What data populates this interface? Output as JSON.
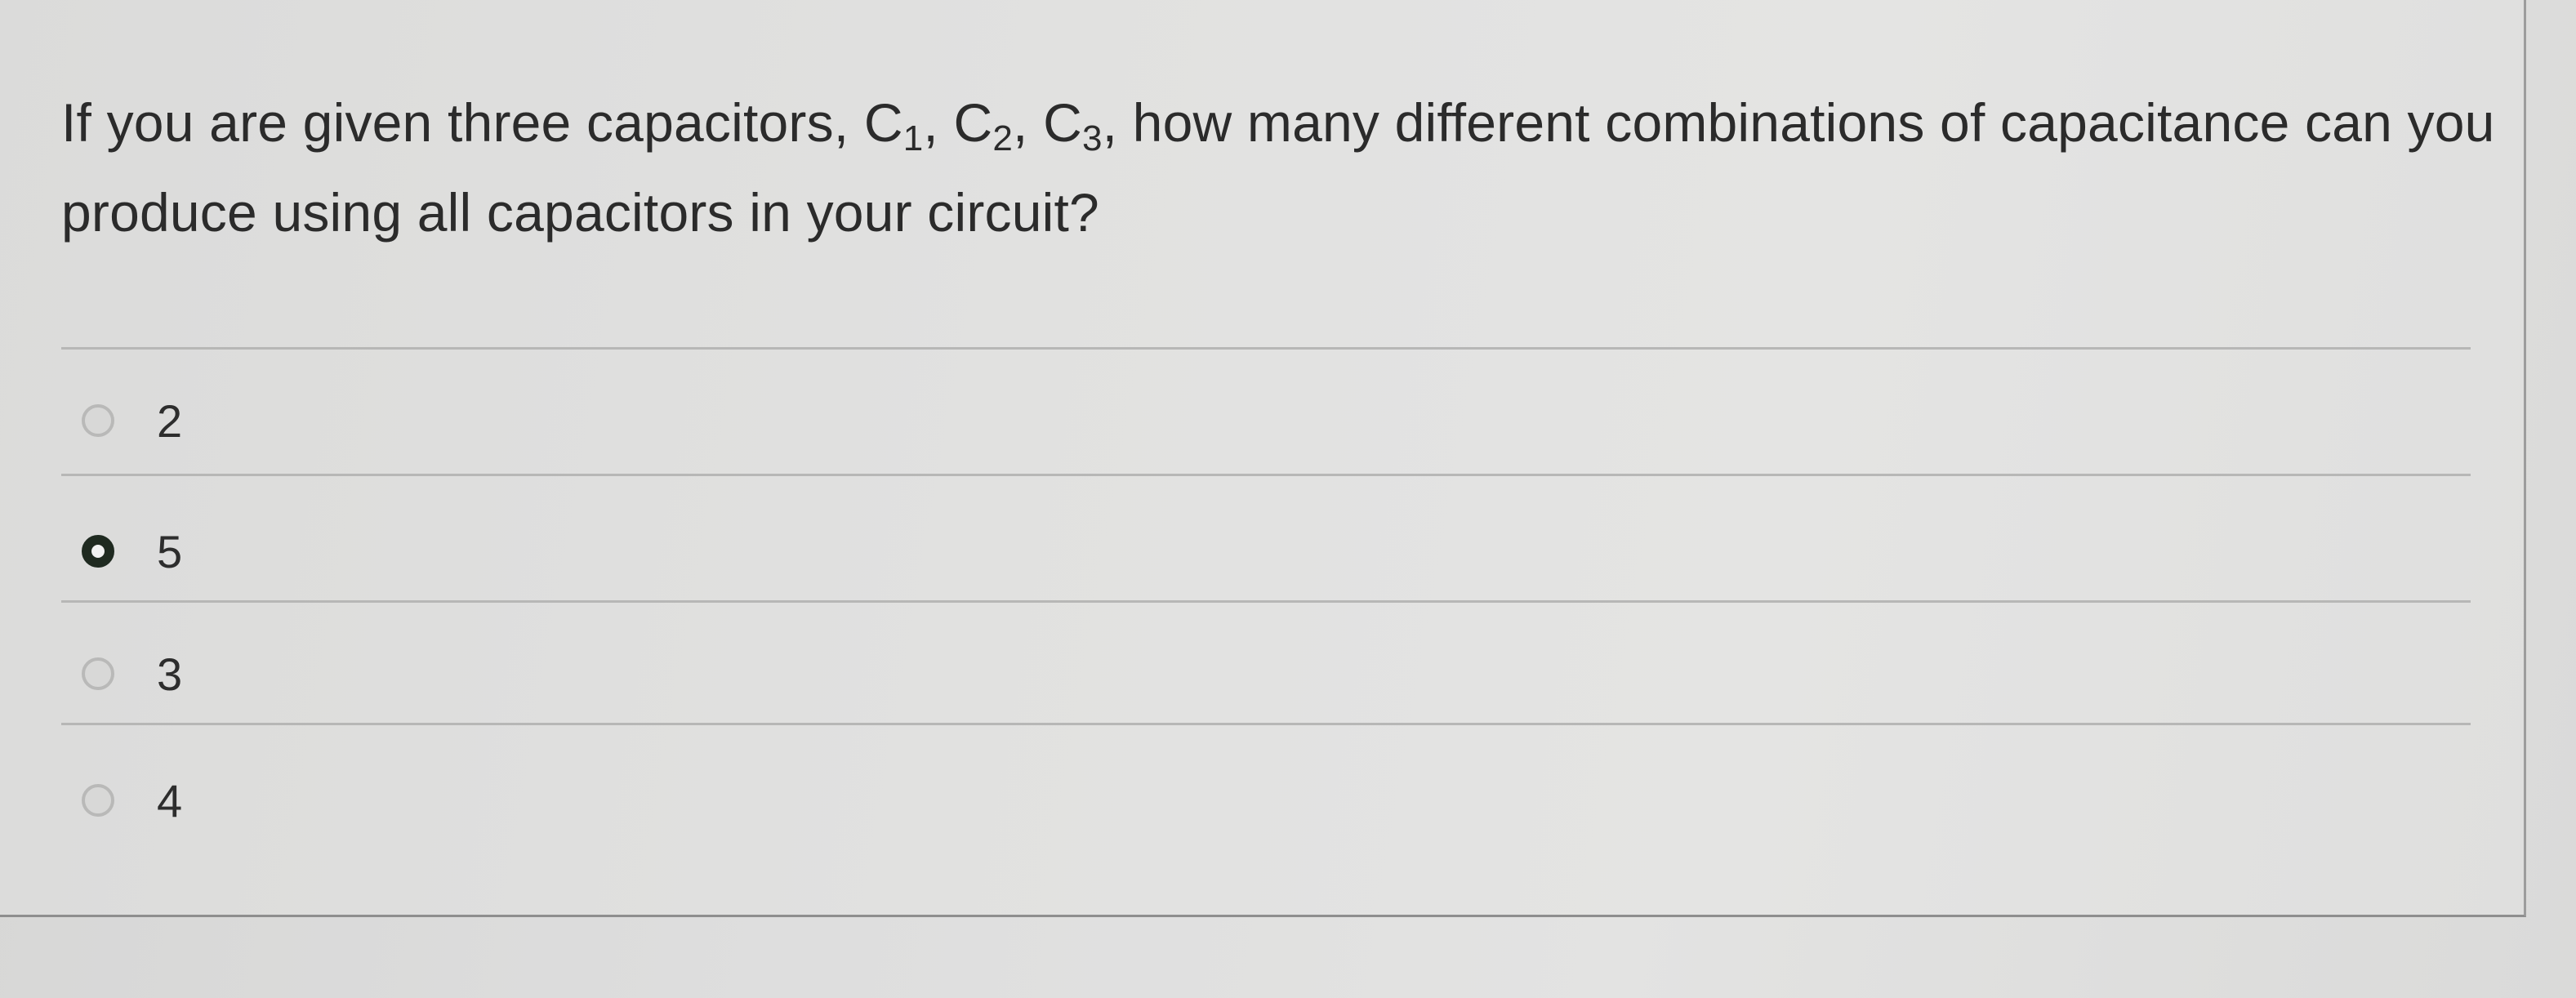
{
  "question": {
    "text_part1": "If you are given three capacitors, C",
    "sub1": "1",
    "text_part2": ", C",
    "sub2": "2",
    "text_part3": ", C",
    "sub3": "3",
    "text_part4": ", how many different combinations of capacitance can you produce using all capacitors in your circuit?"
  },
  "options": [
    {
      "label": "2",
      "selected": false
    },
    {
      "label": "5",
      "selected": true
    },
    {
      "label": "3",
      "selected": false
    },
    {
      "label": "4",
      "selected": false
    }
  ]
}
